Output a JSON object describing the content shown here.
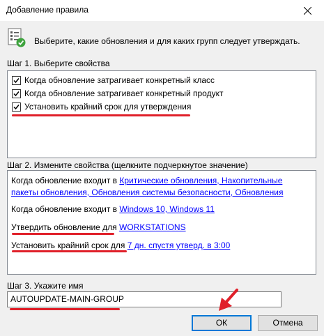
{
  "window": {
    "title": "Добавление правила"
  },
  "header": {
    "text": "Выберите, какие обновления и для каких групп следует утверждать."
  },
  "step1": {
    "label": "Шаг 1. Выберите свойства",
    "items": [
      {
        "label": "Когда обновление затрагивает конкретный класс",
        "checked": true
      },
      {
        "label": "Когда обновление затрагивает конкретный продукт",
        "checked": true
      },
      {
        "label": "Установить крайний срок для утверждения",
        "checked": true
      }
    ]
  },
  "step2": {
    "label": "Шаг 2. Измените свойства (щелкните подчеркнутое значение)",
    "class_prefix": "Когда обновление входит в ",
    "class_link_line1": "Критические обновления, Накопительные",
    "class_link_line2": "пакеты обновления, Обновления системы безопасности, Обновления",
    "product_prefix": "Когда обновление входит в ",
    "product_link": "Windows 10, Windows 11",
    "approve_prefix": "Утвердить обновление для ",
    "approve_link": "WORKSTATIONS",
    "deadline_prefix": "Установить крайний срок для ",
    "deadline_link": "7 дн. спустя утверд. в 3:00"
  },
  "step3": {
    "label": "Шаг 3. Укажите имя",
    "name_value": "AUTOUPDATE-MAIN-GROUP"
  },
  "buttons": {
    "ok": "ОК",
    "cancel": "Отмена"
  },
  "colors": {
    "link": "#0000ff",
    "highlight": "#e0202a",
    "focus_border": "#0078d7"
  }
}
